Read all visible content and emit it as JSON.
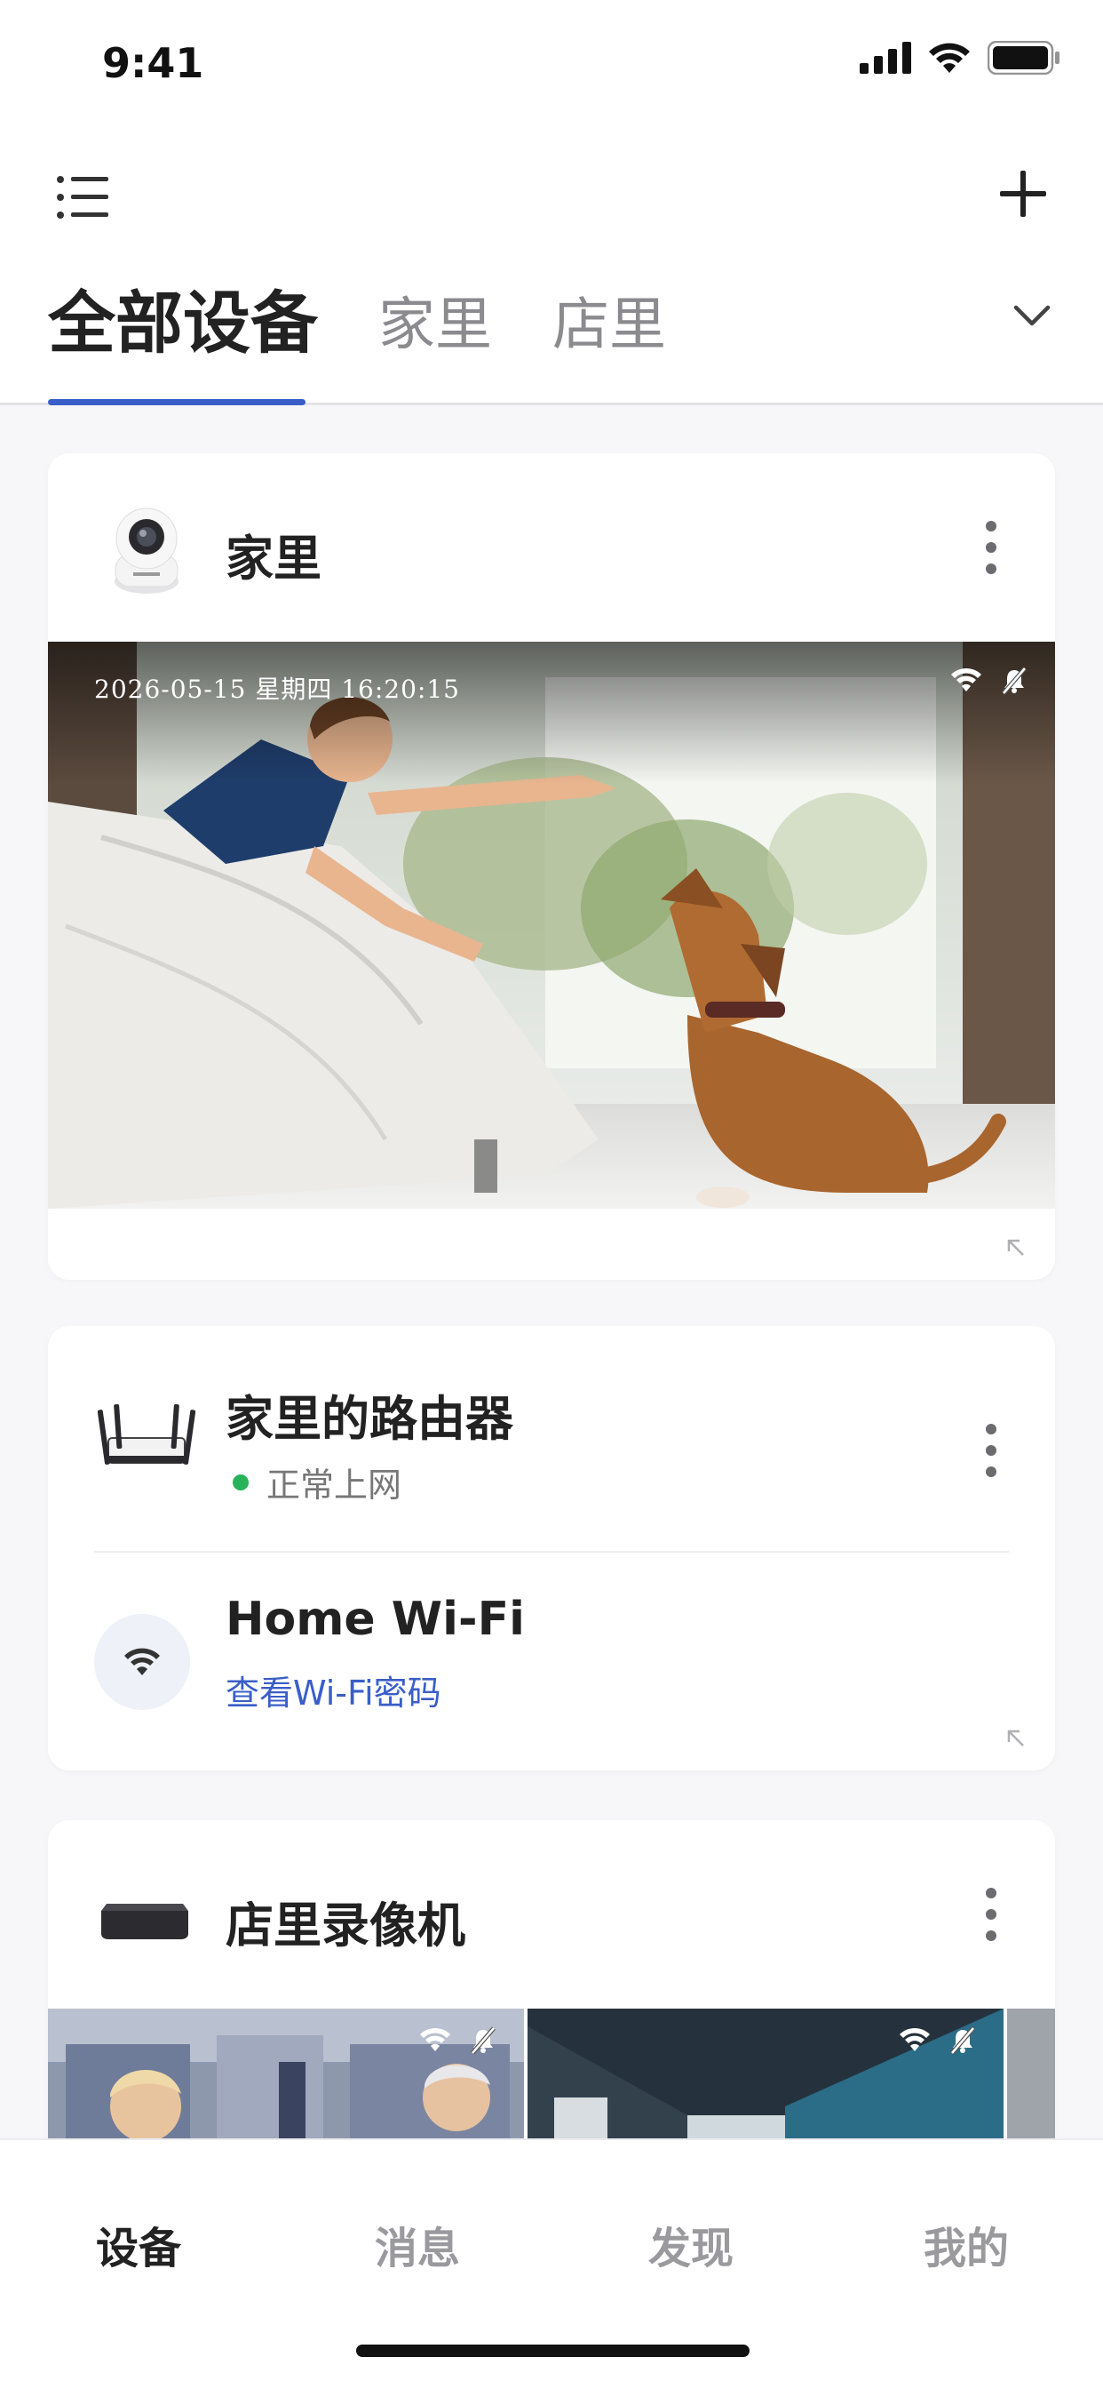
{
  "status_bar": {
    "time": "9:41"
  },
  "header": {
    "tabs": [
      {
        "label": "全部设备",
        "active": true
      },
      {
        "label": "家里",
        "active": false
      },
      {
        "label": "店里",
        "active": false
      }
    ]
  },
  "devices": {
    "camera": {
      "title": "家里",
      "timestamp": "2026-05-15 星期四 16:20:15"
    },
    "router": {
      "title": "家里的路由器",
      "status": "正常上网",
      "status_color": "#26b35a",
      "wifi_name": "Home Wi-Fi",
      "wifi_link": "查看Wi-Fi密码"
    },
    "nvr": {
      "title": "店里录像机"
    }
  },
  "tabbar": {
    "items": [
      {
        "label": "设备",
        "active": true
      },
      {
        "label": "消息",
        "active": false
      },
      {
        "label": "发现",
        "active": false
      },
      {
        "label": "我的",
        "active": false
      }
    ]
  },
  "colors": {
    "accent": "#3a5ec8",
    "online": "#26b35a"
  }
}
